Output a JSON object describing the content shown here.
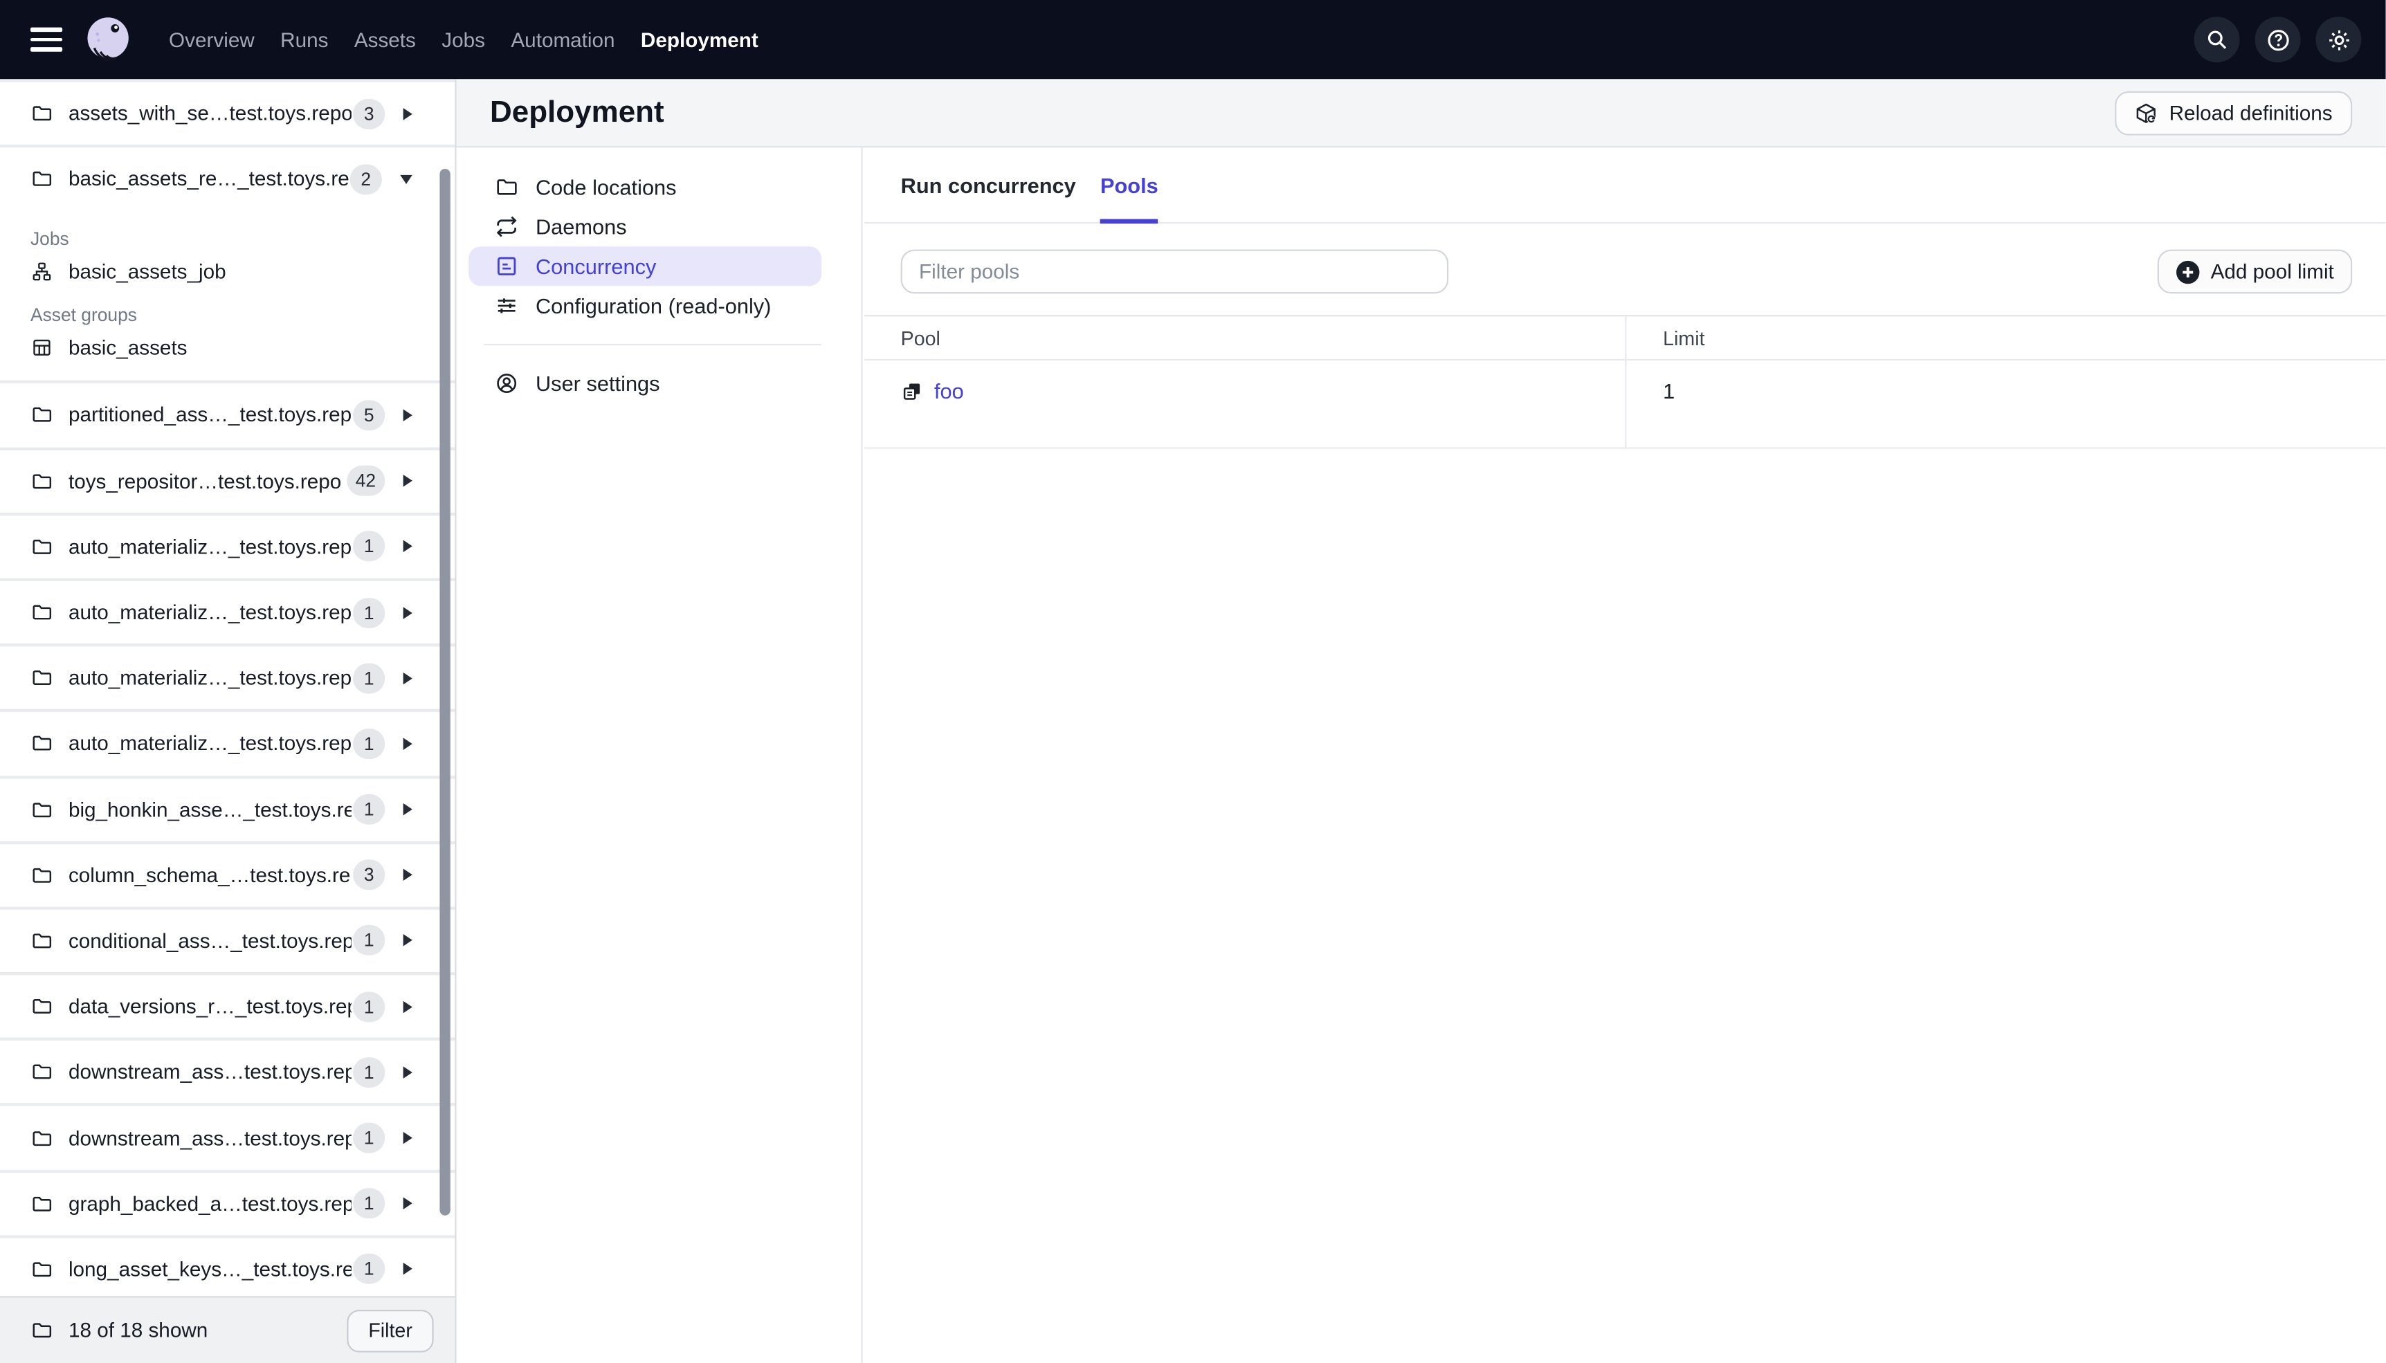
{
  "topbar": {
    "nav": [
      {
        "label": "Overview",
        "active": false
      },
      {
        "label": "Runs",
        "active": false
      },
      {
        "label": "Assets",
        "active": false
      },
      {
        "label": "Jobs",
        "active": false
      },
      {
        "label": "Automation",
        "active": false
      },
      {
        "label": "Deployment",
        "active": true
      }
    ],
    "actions": [
      "search-icon",
      "help-icon",
      "settings-icon"
    ]
  },
  "sidebar": {
    "rows": [
      {
        "name": "assets_with_se…test.toys.repo",
        "badge": "3",
        "expanded": false
      },
      {
        "name": "basic_assets_re…_test.toys.rep",
        "badge": "2",
        "expanded": true
      },
      {
        "name": "partitioned_ass…_test.toys.rep",
        "badge": "5",
        "expanded": false
      },
      {
        "name": "toys_repositor…test.toys.repo",
        "badge": "42",
        "expanded": false
      },
      {
        "name": "auto_materializ…_test.toys.repo",
        "badge": "1",
        "expanded": false
      },
      {
        "name": "auto_materializ…_test.toys.repo",
        "badge": "1",
        "expanded": false
      },
      {
        "name": "auto_materializ…_test.toys.repo",
        "badge": "1",
        "expanded": false
      },
      {
        "name": "auto_materializ…_test.toys.repo",
        "badge": "1",
        "expanded": false
      },
      {
        "name": "big_honkin_asse…_test.toys.rep",
        "badge": "1",
        "expanded": false
      },
      {
        "name": "column_schema_…test.toys.rep",
        "badge": "3",
        "expanded": false
      },
      {
        "name": "conditional_ass…_test.toys.repo",
        "badge": "1",
        "expanded": false
      },
      {
        "name": "data_versions_r…_test.toys.rep",
        "badge": "1",
        "expanded": false
      },
      {
        "name": "downstream_ass…test.toys.rep",
        "badge": "1",
        "expanded": false
      },
      {
        "name": "downstream_ass…test.toys.rep",
        "badge": "1",
        "expanded": false
      },
      {
        "name": "graph_backed_a…test.toys.repo",
        "badge": "1",
        "expanded": false
      },
      {
        "name": "long_asset_keys…_test.toys.rep",
        "badge": "1",
        "expanded": false
      }
    ],
    "expanded": {
      "jobs_label": "Jobs",
      "job": "basic_assets_job",
      "asset_groups_label": "Asset groups",
      "asset_group": "basic_assets"
    },
    "footer": {
      "count": "18 of 18 shown",
      "filter": "Filter"
    }
  },
  "deployment": {
    "title": "Deployment",
    "reload": "Reload definitions",
    "subnav": [
      {
        "label": "Code locations",
        "active": false
      },
      {
        "label": "Daemons",
        "active": false
      },
      {
        "label": "Concurrency",
        "active": true
      },
      {
        "label": "Configuration (read-only)",
        "active": false
      }
    ],
    "user_settings": "User settings",
    "tabs": [
      {
        "label": "Run concurrency",
        "active": false
      },
      {
        "label": "Pools",
        "active": true
      }
    ],
    "filter_placeholder": "Filter pools",
    "add_pool_limit": "Add pool limit",
    "table": {
      "col_pool": "Pool",
      "col_limit": "Limit",
      "rows": [
        {
          "pool": "foo",
          "limit": "1"
        }
      ]
    }
  },
  "colors": {
    "topbar_bg": "#0B0E1D",
    "accent": "#4440D8",
    "selected_pill_bg": "#E8E6FB"
  }
}
